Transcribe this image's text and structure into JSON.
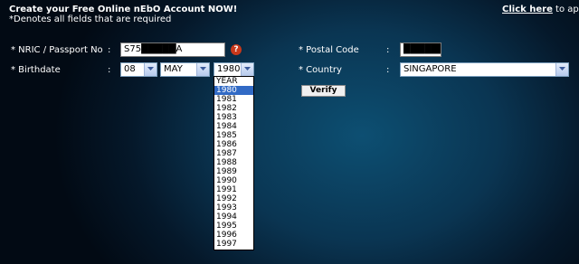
{
  "header": {
    "title": "Create your Free Online nEbO Account NOW!",
    "required_note": "*Denotes all fields that are required",
    "apply_link": "Click here",
    "apply_suffix": " to apply"
  },
  "form": {
    "nric": {
      "label": "* NRIC / Passport No",
      "colon": ":",
      "value": "S75█████A"
    },
    "birthdate": {
      "label": "* Birthdate",
      "colon": ":",
      "day": "08",
      "month": "MAY",
      "year": "1980"
    },
    "postal_code": {
      "label": "* Postal Code",
      "colon": ":",
      "value": "██████"
    },
    "country": {
      "label": "* Country",
      "colon": ":",
      "value": "SINGAPORE"
    },
    "verify_label": "Verify",
    "help_icon": "?"
  },
  "year_dropdown": {
    "options": [
      "YEAR",
      "1980",
      "1981",
      "1982",
      "1983",
      "1984",
      "1985",
      "1986",
      "1987",
      "1988",
      "1989",
      "1990",
      "1991",
      "1992",
      "1993",
      "1994",
      "1995",
      "1996",
      "1997"
    ],
    "selected": "1980"
  },
  "icons": {
    "help": "help-icon",
    "dropdown": "chevron-down-icon"
  },
  "colors": {
    "selected_option": "#316ac5",
    "help_icon": "#c8381a"
  }
}
